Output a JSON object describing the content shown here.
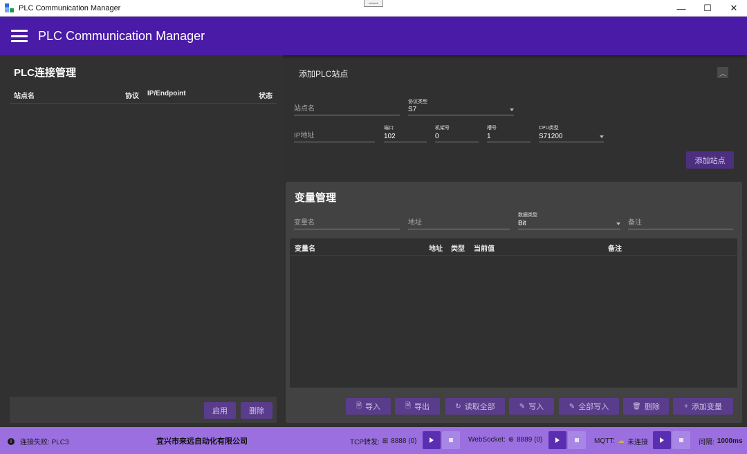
{
  "window": {
    "title": "PLC Communication Manager",
    "minimize": "—",
    "maximize": "☐",
    "close": "✕"
  },
  "appbar": {
    "title": "PLC Communication Manager"
  },
  "left": {
    "title": "PLC连接管理",
    "columns": {
      "name": "站点名",
      "protocol": "协议",
      "endpoint": "IP/Endpoint",
      "status": "状态"
    },
    "enable_label": "启用",
    "delete_label": "删除"
  },
  "add_station": {
    "title": "添加PLC站点",
    "collapse_icon": "chevron-up-icon",
    "station_name_placeholder": "站点名",
    "protocol_label": "协议类型",
    "protocol_value": "S7",
    "ip_placeholder": "IP地址",
    "port_label": "端口",
    "port_value": "102",
    "rack_label": "机架号",
    "rack_value": "0",
    "slot_label": "槽号",
    "slot_value": "1",
    "cpu_label": "CPU类型",
    "cpu_value": "S71200",
    "add_button": "添加站点"
  },
  "variables": {
    "title": "变量管理",
    "name_placeholder": "变量名",
    "address_placeholder": "地址",
    "datatype_label": "数据类型",
    "datatype_value": "Bit",
    "remark_placeholder": "备注",
    "columns": {
      "name": "变量名",
      "address": "地址",
      "type": "类型",
      "current": "当前值",
      "remark": "备注"
    },
    "buttons": {
      "import": "导入",
      "export": "导出",
      "read_all": "读取全部",
      "write": "写入",
      "write_all": "全部写入",
      "delete": "删除",
      "add_var": "添加变量"
    }
  },
  "status": {
    "connection": "连接失败: PLC3",
    "company": "宜兴市来远自动化有限公司",
    "tcp_label": "TCP转发:",
    "tcp_value": "8888 (0)",
    "ws_label": "WebSocket:",
    "ws_value": "8889 (0)",
    "mqtt_label": "MQTT:",
    "mqtt_value": "未连接",
    "interval_label": "间隔:",
    "interval_value": "1000ms"
  },
  "colors": {
    "accent": "#4a1ba6",
    "status_bar": "#9b6fe0",
    "button": "#5a3c8c"
  }
}
